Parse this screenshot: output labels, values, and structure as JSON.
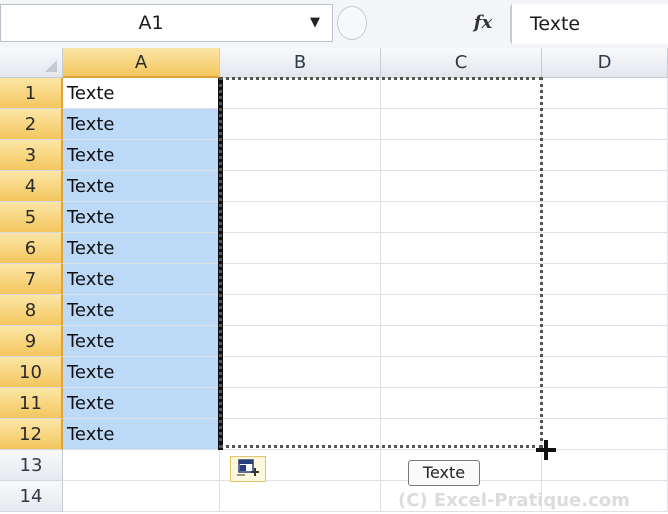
{
  "formula_bar": {
    "name_box_value": "A1",
    "dropdown_icon": "chevron-down-icon",
    "fx_label": "fx",
    "formula_value": "Texte"
  },
  "columns": [
    {
      "name": "A",
      "selected": true
    },
    {
      "name": "B",
      "selected": false
    },
    {
      "name": "C",
      "selected": false
    },
    {
      "name": "D",
      "selected": false
    }
  ],
  "rows": [
    {
      "num": "1",
      "a": "Texte",
      "selected": true,
      "active": true
    },
    {
      "num": "2",
      "a": "Texte",
      "selected": true
    },
    {
      "num": "3",
      "a": "Texte",
      "selected": true
    },
    {
      "num": "4",
      "a": "Texte",
      "selected": true
    },
    {
      "num": "5",
      "a": "Texte",
      "selected": true
    },
    {
      "num": "6",
      "a": "Texte",
      "selected": true
    },
    {
      "num": "7",
      "a": "Texte",
      "selected": true
    },
    {
      "num": "8",
      "a": "Texte",
      "selected": true
    },
    {
      "num": "9",
      "a": "Texte",
      "selected": true
    },
    {
      "num": "10",
      "a": "Texte",
      "selected": true
    },
    {
      "num": "11",
      "a": "Texte",
      "selected": true
    },
    {
      "num": "12",
      "a": "Texte",
      "selected": true
    },
    {
      "num": "13",
      "a": "",
      "selected": false
    },
    {
      "num": "14",
      "a": "",
      "selected": false
    }
  ],
  "drag_tooltip": "Texte",
  "watermark": "(C) Excel-Pratique.com",
  "colors": {
    "selection": "#bcd9f8",
    "header_selected": "#f4c65e",
    "header_normal": "#e3e7ed"
  }
}
